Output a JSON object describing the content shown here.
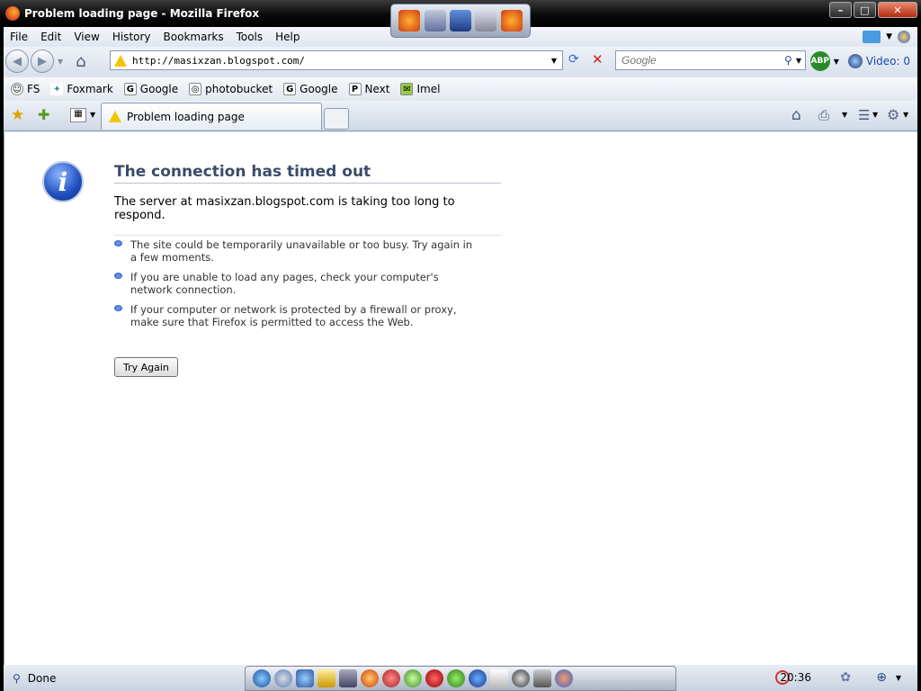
{
  "window": {
    "title": "Problem loading page - Mozilla Firefox"
  },
  "menubar": {
    "items": [
      "File",
      "Edit",
      "View",
      "History",
      "Bookmarks",
      "Tools",
      "Help"
    ]
  },
  "navbar": {
    "url": "http://masixzan.blogspot.com/",
    "search_placeholder": "Google",
    "video_label": "Video: 0",
    "abp_label": "ABP"
  },
  "bookmarks": [
    {
      "label": "FS",
      "icon": "smiley-icon"
    },
    {
      "label": "Foxmark",
      "icon": "foxmark-icon"
    },
    {
      "label": "Google",
      "icon": "google-icon"
    },
    {
      "label": "photobucket",
      "icon": "photobucket-icon"
    },
    {
      "label": "Google",
      "icon": "google-icon"
    },
    {
      "label": "Next",
      "icon": "next-icon"
    },
    {
      "label": "Imel",
      "icon": "mail-icon"
    }
  ],
  "tab": {
    "label": "Problem loading page"
  },
  "error": {
    "title": "The connection has timed out",
    "description": "The server at masixzan.blogspot.com is taking too long to respond.",
    "suggestions": [
      "The site could be temporarily unavailable or too busy. Try again in a few moments.",
      "If you are unable to load any pages, check your computer's network connection.",
      "If your computer or network is protected by a firewall or proxy, make sure that Firefox is permitted to access the Web."
    ],
    "try_again_label": "Try Again"
  },
  "statusbar": {
    "status": "Done",
    "clock": "20:36"
  },
  "colors": {
    "title_text": "#3a4c6a",
    "accent": "#1f4fc0"
  }
}
